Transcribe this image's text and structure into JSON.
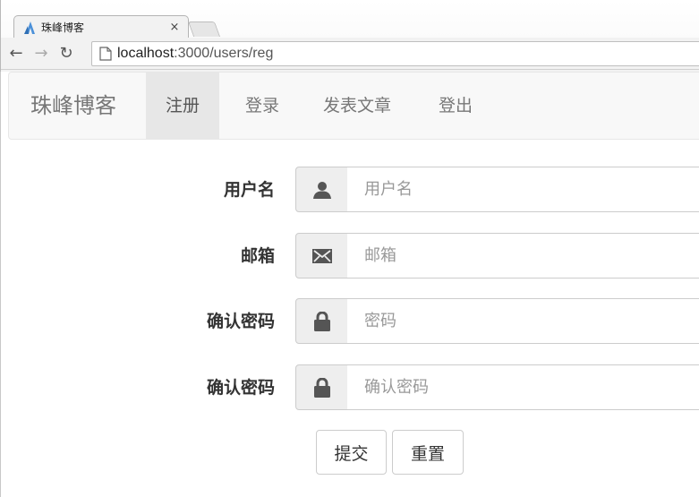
{
  "browser": {
    "tab_title": "珠峰博客",
    "tab_close": "×",
    "url_host": "localhost",
    "url_rest": ":3000/users/reg",
    "back_glyph": "←",
    "forward_glyph": "→",
    "reload_glyph": "↻"
  },
  "navbar": {
    "brand": "珠峰博客",
    "items": [
      {
        "label": "注册",
        "active": true
      },
      {
        "label": "登录",
        "active": false
      },
      {
        "label": "发表文章",
        "active": false
      },
      {
        "label": "登出",
        "active": false
      }
    ]
  },
  "form": {
    "rows": [
      {
        "label": "用户名",
        "placeholder": "用户名",
        "icon": "user-icon"
      },
      {
        "label": "邮箱",
        "placeholder": "邮箱",
        "icon": "envelope-icon"
      },
      {
        "label": "确认密码",
        "placeholder": "密码",
        "icon": "lock-icon"
      },
      {
        "label": "确认密码",
        "placeholder": "确认密码",
        "icon": "lock-icon"
      }
    ],
    "submit_label": "提交",
    "reset_label": "重置"
  }
}
